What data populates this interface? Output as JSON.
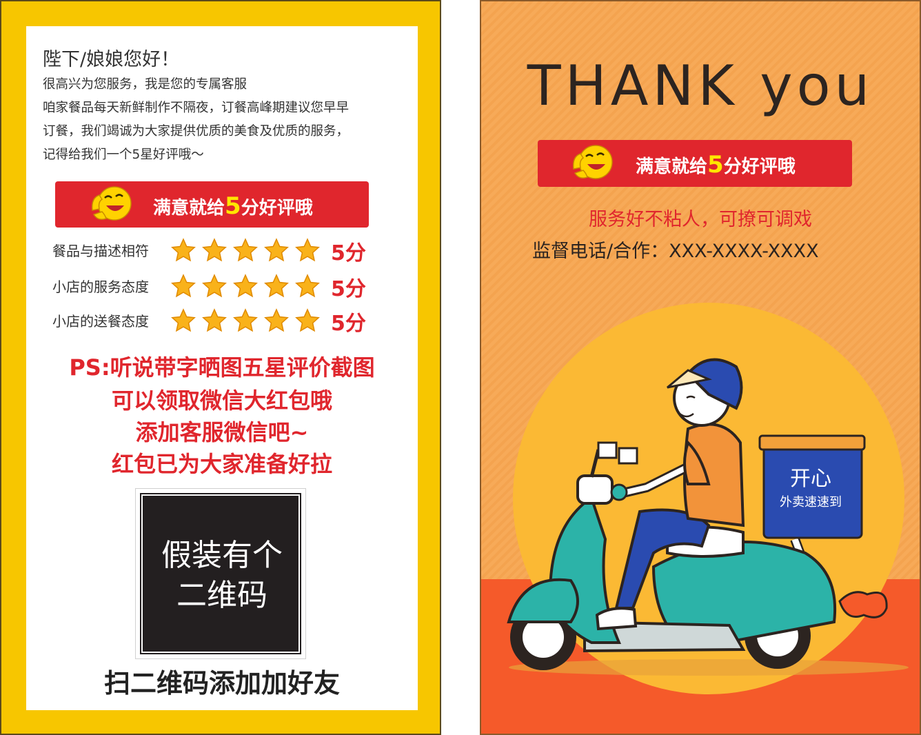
{
  "left_card": {
    "greeting": "陛下/娘娘您好！",
    "intro_lines": [
      "很高兴为您服务，我是您的专属客服",
      "咱家餐品每天新鲜制作不隔夜，订餐高峰期建议您早早",
      "订餐，我们竭诚为大家提供优质的美食及优质的服务，",
      "记得给我们一个5星好评哦～"
    ],
    "banner": {
      "prefix": "满意就给",
      "number": "5",
      "suffix": "分好评哦"
    },
    "ratings": [
      {
        "label": "餐品与描述相符",
        "stars": 5,
        "score": "5分"
      },
      {
        "label": "小店的服务态度",
        "stars": 5,
        "score": "5分"
      },
      {
        "label": "小店的送餐态度",
        "stars": 5,
        "score": "5分"
      }
    ],
    "ps_lines": [
      "PS:听说带字晒图五星评价截图",
      "可以领取微信大红包哦",
      "添加客服微信吧~",
      "红包已为大家准备好拉"
    ],
    "qr_placeholder": {
      "line1": "假装有个",
      "line2": "二维码"
    },
    "scan_text": "扫二维码添加加好友"
  },
  "right_card": {
    "title": "THANK you",
    "banner": {
      "prefix": "满意就给",
      "number": "5",
      "suffix": "分好评哦"
    },
    "service_text": "服务好不粘人，可撩可调戏",
    "contact_text": "监督电话/合作：XXX-XXXX-XXXX",
    "box_text": {
      "line1": "开心",
      "line2": "外卖速速到"
    }
  },
  "colors": {
    "yellow_frame": "#f7c600",
    "red": "#e0262d",
    "orange_bg": "#f7aa58",
    "circle": "#fbb934",
    "bottom_band": "#f55a2a"
  }
}
